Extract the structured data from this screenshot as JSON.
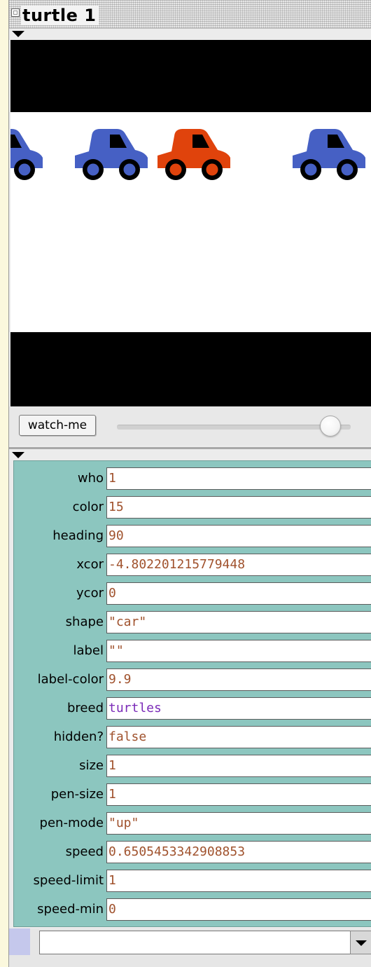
{
  "window": {
    "title": "turtle 1"
  },
  "view": {
    "road_color": "#ffffff",
    "background_color": "#000000",
    "car_colors": {
      "blue": "#4660c4",
      "red": "#e0430c"
    }
  },
  "controls": {
    "watch_button_label": "watch-me"
  },
  "properties": [
    {
      "label": "who",
      "value": "1"
    },
    {
      "label": "color",
      "value": "15"
    },
    {
      "label": "heading",
      "value": "90"
    },
    {
      "label": "xcor",
      "value": "-4.802201215779448"
    },
    {
      "label": "ycor",
      "value": "0"
    },
    {
      "label": "shape",
      "value": "\"car\""
    },
    {
      "label": "label",
      "value": "\"\""
    },
    {
      "label": "label-color",
      "value": "9.9"
    },
    {
      "label": "breed",
      "value": "turtles"
    },
    {
      "label": "hidden?",
      "value": "false"
    },
    {
      "label": "size",
      "value": "1"
    },
    {
      "label": "pen-size",
      "value": "1"
    },
    {
      "label": "pen-mode",
      "value": "\"up\""
    },
    {
      "label": "speed",
      "value": "0.6505453342908853"
    },
    {
      "label": "speed-limit",
      "value": "1"
    },
    {
      "label": "speed-min",
      "value": "0"
    }
  ],
  "command": {
    "value": ""
  },
  "icons": [
    "close-box-icon",
    "collapse-triangle-icon",
    "car-icon",
    "dropdown-arrow-icon"
  ]
}
